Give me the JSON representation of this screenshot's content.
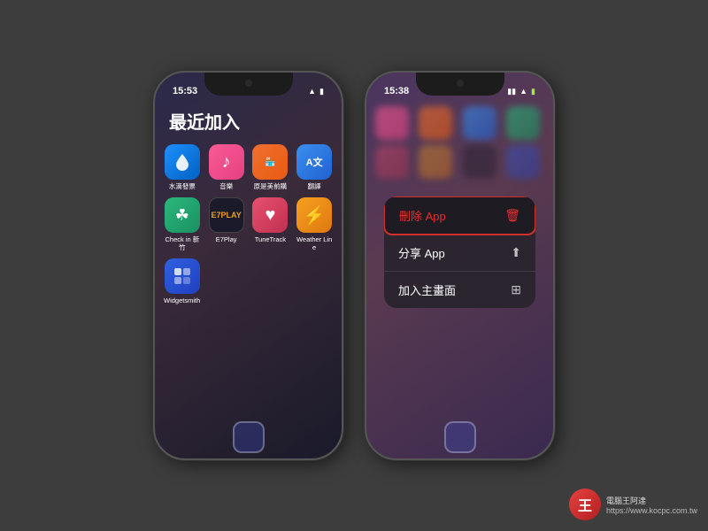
{
  "page": {
    "background": "#3d3d3d"
  },
  "phone1": {
    "time": "15:53",
    "title": "最近加入",
    "apps_row1": [
      {
        "name": "水滴發票",
        "icon_class": "icon-water",
        "symbol": "💧"
      },
      {
        "name": "音樂",
        "icon_class": "icon-music",
        "symbol": "♪"
      },
      {
        "name": "原是美前購",
        "icon_class": "icon-shopping",
        "symbol": "🏪"
      },
      {
        "name": "翻譯",
        "icon_class": "icon-translate",
        "symbol": "A文"
      }
    ],
    "apps_row2": [
      {
        "name": "Check in 新竹",
        "icon_class": "icon-checkin",
        "symbol": "☘"
      },
      {
        "name": "E7Play",
        "icon_class": "icon-e7play",
        "symbol": "E7"
      },
      {
        "name": "TuneTrack",
        "icon_class": "icon-tunetrack",
        "symbol": "♥"
      },
      {
        "name": "Weather Line",
        "icon_class": "icon-weatherline",
        "symbol": "⚡"
      }
    ],
    "widgetsmith_name": "Widgetsmith"
  },
  "phone2": {
    "time": "15:38",
    "context_menu": {
      "item1": {
        "label": "刪除 App",
        "icon": "🗑",
        "type": "delete"
      },
      "item2": {
        "label": "分享 App",
        "icon": "↑",
        "type": "normal"
      },
      "item3": {
        "label": "加入主畫面",
        "icon": "⊞",
        "type": "normal"
      }
    }
  },
  "watermark": {
    "logo": "王",
    "line1": "電腦王阿達",
    "line2": "https://www.kocpc.com.tw"
  }
}
